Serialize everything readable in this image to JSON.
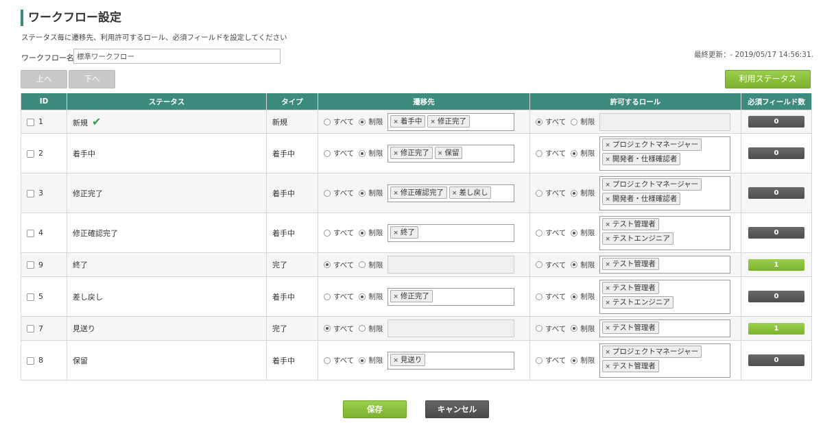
{
  "page": {
    "title": "ワークフロー設定",
    "description": "ステータス毎に遷移先、利用許可するロール、必須フィールドを設定してください",
    "workflow_name_label": "ワークフロー名",
    "workflow_name_value": "標準ワークフロー",
    "last_updated": "最終更新：- 2019/05/17 14:56:31.",
    "up_label": "上へ",
    "down_label": "下へ",
    "used_status_label": "利用ステータス",
    "save_label": "保存",
    "cancel_label": "キャンセル"
  },
  "colors": {
    "header_bg": "#3d8b7d",
    "accent_green": "#7cb22e",
    "dark_button": "#4d4d4d"
  },
  "table": {
    "headers": [
      "ID",
      "ステータス",
      "タイプ",
      "遷移先",
      "許可するロール",
      "必須フィールド数"
    ],
    "option_all": "すべて",
    "option_limit": "制限",
    "rows": [
      {
        "id": "1",
        "status": "新規",
        "initial": true,
        "type": "新規",
        "trans_mode": "limit",
        "transitions": [
          "着手中",
          "修正完了"
        ],
        "role_mode": "all",
        "roles": [],
        "required_count": "0"
      },
      {
        "id": "2",
        "status": "着手中",
        "initial": false,
        "type": "着手中",
        "trans_mode": "limit",
        "transitions": [
          "修正完了",
          "保留"
        ],
        "role_mode": "limit",
        "roles": [
          "プロジェクトマネージャー",
          "開発者・仕様確認者"
        ],
        "required_count": "0"
      },
      {
        "id": "3",
        "status": "修正完了",
        "initial": false,
        "type": "着手中",
        "trans_mode": "limit",
        "transitions": [
          "修正確認完了",
          "差し戻し"
        ],
        "role_mode": "limit",
        "roles": [
          "プロジェクトマネージャー",
          "開発者・仕様確認者"
        ],
        "required_count": "0"
      },
      {
        "id": "4",
        "status": "修正確認完了",
        "initial": false,
        "type": "着手中",
        "trans_mode": "limit",
        "transitions": [
          "終了"
        ],
        "role_mode": "limit",
        "roles": [
          "テスト管理者",
          "テストエンジニア"
        ],
        "required_count": "0"
      },
      {
        "id": "9",
        "status": "終了",
        "initial": false,
        "type": "完了",
        "trans_mode": "all",
        "transitions": [],
        "role_mode": "limit",
        "roles": [
          "テスト管理者"
        ],
        "required_count": "1"
      },
      {
        "id": "5",
        "status": "差し戻し",
        "initial": false,
        "type": "着手中",
        "trans_mode": "limit",
        "transitions": [
          "修正完了"
        ],
        "role_mode": "limit",
        "roles": [
          "テスト管理者",
          "テストエンジニア"
        ],
        "required_count": "0"
      },
      {
        "id": "7",
        "status": "見送り",
        "initial": false,
        "type": "完了",
        "trans_mode": "all",
        "transitions": [],
        "role_mode": "limit",
        "roles": [
          "テスト管理者"
        ],
        "required_count": "1"
      },
      {
        "id": "8",
        "status": "保留",
        "initial": false,
        "type": "着手中",
        "trans_mode": "limit",
        "transitions": [
          "見送り"
        ],
        "role_mode": "limit",
        "roles": [
          "プロジェクトマネージャー",
          "テスト管理者"
        ],
        "required_count": "0"
      }
    ]
  }
}
